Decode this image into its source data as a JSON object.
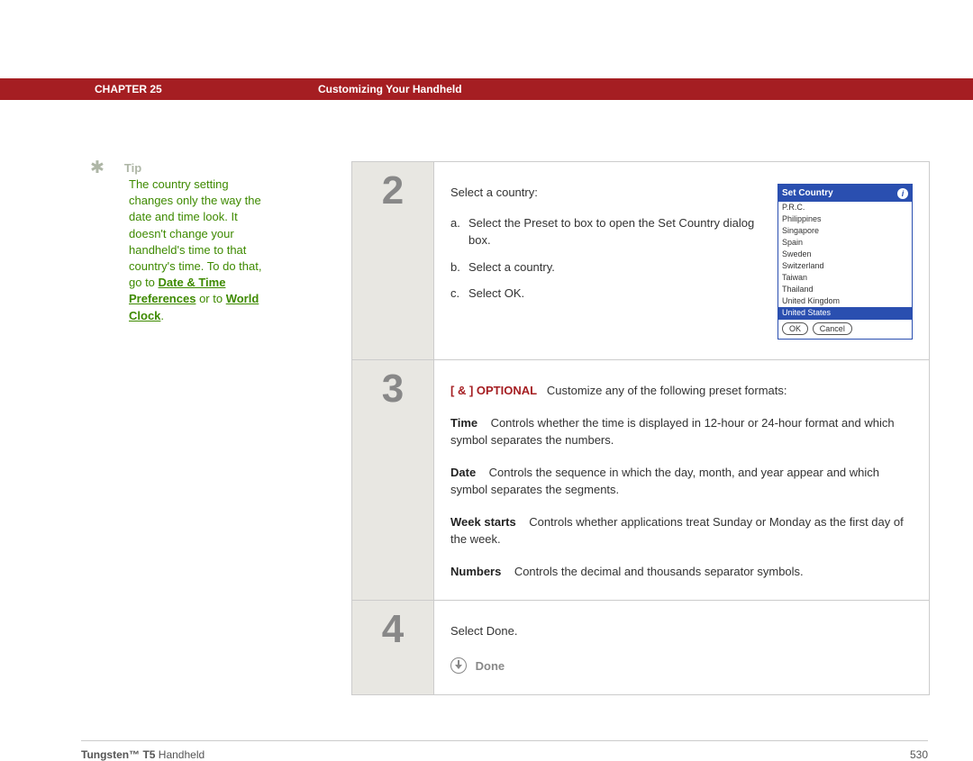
{
  "header": {
    "chapter_label": "CHAPTER 25",
    "page_title": "Customizing Your Handheld"
  },
  "tip": {
    "label": "Tip",
    "body_pre": "The country setting changes only the way the date and time look. It doesn't change your handheld's time to that country's time. To do that, go to ",
    "link1": "Date & Time Preferences",
    "mid": " or to ",
    "link2": "World Clock",
    "end": "."
  },
  "steps": {
    "s2": {
      "num": "2",
      "intro": "Select a country:",
      "a_letter": "a.",
      "a_text": "Select the Preset to box to open the Set Country dialog box.",
      "b_letter": "b.",
      "b_text": "Select a country.",
      "c_letter": "c.",
      "c_text": "Select OK."
    },
    "s3": {
      "num": "3",
      "optional_prefix": "[ & ]  OPTIONAL",
      "optional_text": "Customize any of the following preset formats:",
      "time_term": "Time",
      "time_def": "Controls whether the time is displayed in 12-hour or 24-hour format and which symbol separates the numbers.",
      "date_term": "Date",
      "date_def": "Controls the sequence in which the day, month, and year appear and which symbol separates the segments.",
      "week_term": "Week starts",
      "week_def": "Controls whether applications treat Sunday or Monday as the first day of the week.",
      "num_term": "Numbers",
      "num_def": "Controls the decimal and thousands separator symbols."
    },
    "s4": {
      "num": "4",
      "text": "Select Done.",
      "done": "Done"
    }
  },
  "dialog": {
    "title": "Set Country",
    "items": [
      "P.R.C.",
      "Philippines",
      "Singapore",
      "Spain",
      "Sweden",
      "Switzerland",
      "Taiwan",
      "Thailand",
      "United Kingdom",
      "United States"
    ],
    "ok": "OK",
    "cancel": "Cancel"
  },
  "footer": {
    "product_bold": "Tungsten™ T5",
    "product_rest": " Handheld",
    "pagenum": "530"
  }
}
